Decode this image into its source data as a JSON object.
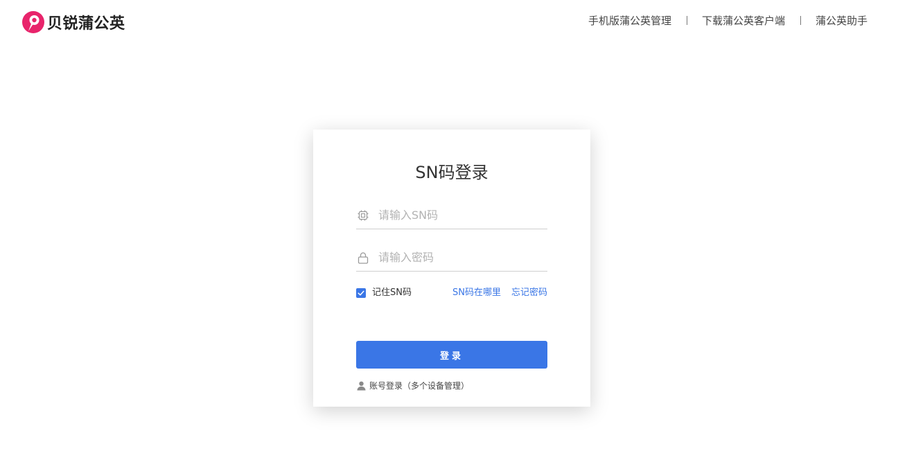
{
  "header": {
    "brand": "贝锐蒲公英",
    "nav": [
      {
        "label": "手机版蒲公英管理"
      },
      {
        "label": "下载蒲公英客户端"
      },
      {
        "label": "蒲公英助手"
      }
    ]
  },
  "login": {
    "title": "SN码登录",
    "sn_field": {
      "placeholder": "请输入SN码",
      "value": "",
      "icon": "chip-icon"
    },
    "password_field": {
      "placeholder": "请输入密码",
      "value": "",
      "icon": "lock-icon"
    },
    "remember": {
      "label": "记住SN码",
      "checked": true
    },
    "where_sn_link": "SN码在哪里",
    "forgot_link": "忘记密码",
    "submit_label": "登录",
    "account_login_link": "账号登录（多个设备管理）",
    "account_icon": "user-icon"
  },
  "colors": {
    "brand": "#e8246b",
    "accent": "#3a76e6"
  }
}
